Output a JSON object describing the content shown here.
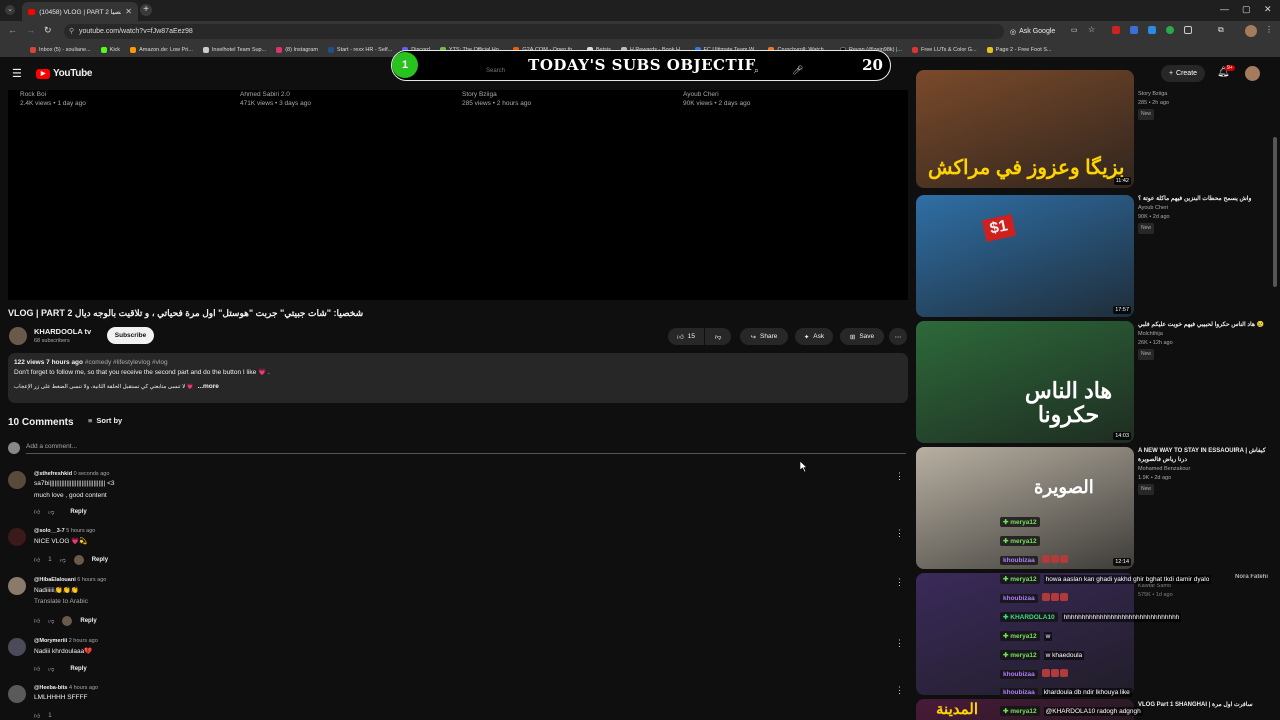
{
  "browser": {
    "tab_title": "(10458) VLOG | PART 2 شخصيا",
    "url": "youtube.com/watch?v=fJw87aEez98",
    "ask_google": "Ask Google",
    "bookmarks": [
      "Inbox (5) - souliane...",
      "Kick",
      "Amazon.de: Low Pri...",
      "Inselhotel Team Sup...",
      "(8) Instagram",
      "Start - rexx HR - Self...",
      "Discord",
      "YTS: The Official Ho...",
      "G2A.COM - Open th...",
      "Betsis",
      "H Rewards - Book H...",
      "FC Ultimate Team W...",
      "Crunchyroll: Watch ...",
      "Revan (@zein98k) |...",
      "Free LUTs & Color G...",
      "Page 2 - Free Foot S..."
    ]
  },
  "youtube": {
    "logo": "YouTube",
    "search_placeholder": "Search",
    "create_label": "Create",
    "notif_count": "9+"
  },
  "overlay": {
    "title": "TODAY'S SUBS OBJECTIF",
    "current": "1",
    "goal": "20"
  },
  "endcards": [
    {
      "channel": "Rock Boi",
      "views": "2.4K views • 1 day ago"
    },
    {
      "channel": "Ahmed Sabiri 2.0",
      "views": "471K views • 3 days ago"
    },
    {
      "channel": "Story Bziiga",
      "views": "285 views • 2 hours ago"
    },
    {
      "channel": "Ayoub Cheri",
      "views": "90K views • 2 days ago"
    }
  ],
  "video": {
    "title": "VLOG | PART 2 شخصيا: \"شات جبيتي\" جربت \"هوستل\" اول مرة فحياتي ، و تلاقيت بالوجه ديال",
    "channel": "KHARDOOLA tv",
    "subscribers": "68 subscribers",
    "subscribe_label": "Subscribe",
    "likes": "15",
    "share_label": "Share",
    "ask_label": "Ask",
    "save_label": "Save"
  },
  "description": {
    "meta": "122 views  7 hours ago",
    "tags": "#comedy #lifestylevlog #vlog",
    "line1": "Don't forget to follow me, so that you receive the second part and do the button I like 💗 .",
    "line2": "لا تنسى متابعتي كي تستقبل الحلقة الثانية، ولا تنسى الضغط على زر الإعجاب 💗",
    "more": "...more"
  },
  "comments_section": {
    "count_label": "10 Comments",
    "sort_label": "Sort by",
    "add_placeholder": "Add a comment...",
    "reply_label": "Reply",
    "items": [
      {
        "handle": "@sthefreshkid",
        "time": "0 seconds ago",
        "text": "sa7bi||||||||||||||||||||||||||||||||| <3",
        "text2": "much love , good content",
        "likes": ""
      },
      {
        "handle": "@solo__3-7",
        "time": "5 hours ago",
        "text": "NICE VLOG 💗💫",
        "text2": "",
        "likes": "1"
      },
      {
        "handle": "@HibaElalouani",
        "time": "6 hours ago",
        "text": "Nadiiiiii👏👏👏",
        "text2": "",
        "translate": "Translate to Arabic",
        "likes": ""
      },
      {
        "handle": "@Morymeriii",
        "time": "2 hours ago",
        "text": "Nadiii khrdoulaaa💔",
        "text2": "",
        "likes": ""
      },
      {
        "handle": "@Heeba-bits",
        "time": "4 hours ago",
        "text": "LMLHHHH SFFFF",
        "text2": "",
        "likes": "1"
      }
    ]
  },
  "sidebar": [
    {
      "title": "",
      "channel": "Story Bziiga",
      "views": "285",
      "age": "2h ago",
      "badge": "New",
      "duration": "11:42",
      "thumb_text": "بزيگا وعزوز في مراكش",
      "thumb_color": "#7a4a2a",
      "text_color": "#ffd400"
    },
    {
      "title": "واش يسمح محطات البنزين فيهم ماكلة عوتة ؟",
      "channel": "Ayoub Cheri",
      "views": "90K",
      "age": "2d ago",
      "badge": "New",
      "duration": "17:57",
      "thumb_text": "$1",
      "thumb_color": "#2f6fa6",
      "text_color": "#ffffff"
    },
    {
      "title": "هاد الناس حكروا لحبيبي فيهم خويت عليكم فلبي 😢",
      "channel": "Molchthija",
      "views": "26K",
      "age": "12h ago",
      "badge": "New",
      "duration": "14:03",
      "thumb_text": "هاد الناس حكرونا",
      "thumb_color": "#2d6a3a",
      "text_color": "#ffffff"
    },
    {
      "title": "A NEW WAY TO STAY IN ESSAOUIRA | كيفاش درنا رياض فالصويرة",
      "channel": "Mohamed Benzakour",
      "views": "1.9K",
      "age": "2d ago",
      "badge": "New",
      "duration": "12:14",
      "thumb_text": "الصويرة",
      "thumb_color": "#b8b0a2",
      "text_color": "#ffffff"
    },
    {
      "title": "Nora Fatehi",
      "channel": "Kawtar Samo",
      "views": "575K",
      "age": "1d ago",
      "badge": "",
      "duration": "",
      "thumb_text": "",
      "thumb_color": "#3a2a5a",
      "text_color": "#ffffff"
    },
    {
      "title": "VLOG Part 1 SHANGHAI | سافرت اول مرة",
      "channel": "",
      "views": "",
      "age": "",
      "badge": "",
      "duration": "",
      "thumb_text": "المدينة",
      "thumb_color": "#4a1a3a",
      "text_color": "#ffd400"
    }
  ],
  "chat": [
    {
      "user": "merya12",
      "color": "#76e05c",
      "msg": ""
    },
    {
      "user": "merya12",
      "color": "#76e05c",
      "msg": ""
    },
    {
      "user": "khoubizaa",
      "color": "#b07cff",
      "msg": "emotes"
    },
    {
      "user": "merya12",
      "color": "#76e05c",
      "msg": "howa aaslan kan ghadi yakhd ghir bghat tkdi damir dyalo"
    },
    {
      "user": "khoubizaa",
      "color": "#b07cff",
      "msg": "emotes"
    },
    {
      "user": "KHARDOLA10",
      "color": "#3ddc84",
      "msg": "hhhhhhhhhhhhhhhhhhhhhhhhhhhhhhhh"
    },
    {
      "user": "merya12",
      "color": "#76e05c",
      "msg": "w"
    },
    {
      "user": "merya12",
      "color": "#76e05c",
      "msg": "w khaedoula"
    },
    {
      "user": "khoubizaa",
      "color": "#b07cff",
      "msg": "emotes"
    },
    {
      "user": "khoubizaa",
      "color": "#b07cff",
      "msg": "khardoula db ndir lkhouya like"
    },
    {
      "user": "merya12",
      "color": "#76e05c",
      "msg": "@KHARDOLA10 radogh adgngh"
    }
  ]
}
